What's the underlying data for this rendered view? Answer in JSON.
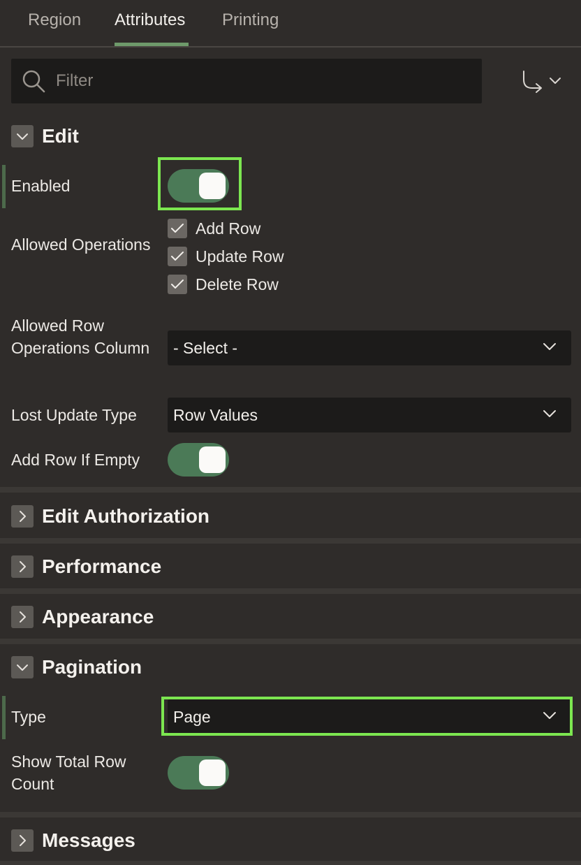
{
  "tabs": [
    {
      "label": "Region"
    },
    {
      "label": "Attributes"
    },
    {
      "label": "Printing"
    }
  ],
  "filter": {
    "placeholder": "Filter"
  },
  "sections": {
    "edit": {
      "title": "Edit",
      "enabled_label": "Enabled",
      "enabled_value": true,
      "allowed_ops_label": "Allowed Operations",
      "operations": [
        {
          "label": "Add Row",
          "checked": true
        },
        {
          "label": "Update Row",
          "checked": true
        },
        {
          "label": "Delete Row",
          "checked": true
        }
      ],
      "row_ops_column_label": "Allowed Row Operations Column",
      "row_ops_column_value": "- Select -",
      "lost_update_label": "Lost Update Type",
      "lost_update_value": "Row Values",
      "add_row_empty_label": "Add Row If Empty",
      "add_row_empty_value": true
    },
    "edit_authorization": {
      "title": "Edit Authorization"
    },
    "performance": {
      "title": "Performance"
    },
    "appearance": {
      "title": "Appearance"
    },
    "pagination": {
      "title": "Pagination",
      "type_label": "Type",
      "type_value": "Page",
      "show_total_label": "Show Total Row Count",
      "show_total_value": true
    },
    "messages": {
      "title": "Messages"
    }
  },
  "colors": {
    "background": "#2f2c2a",
    "toggle_on": "#4b7a57",
    "highlight": "#7ce650",
    "tab_accent": "#6e9a6b"
  }
}
